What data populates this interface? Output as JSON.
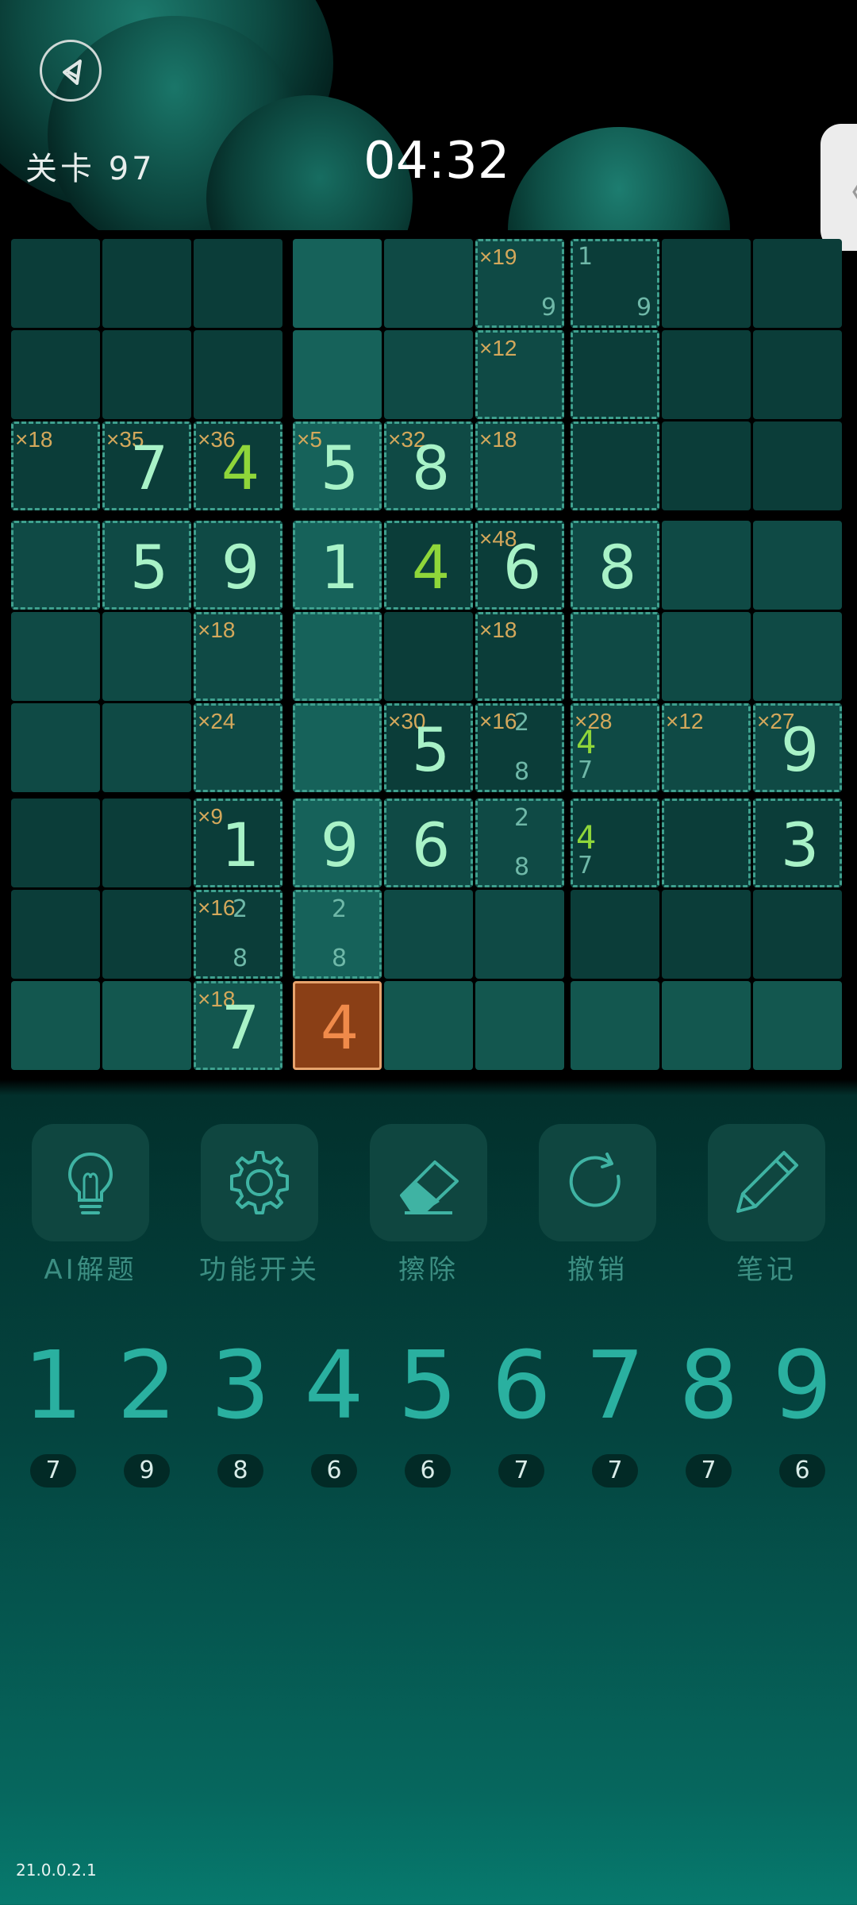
{
  "header": {
    "level": "关卡 97",
    "timer": "04:32",
    "side_tab_glyph": "〈"
  },
  "tools": [
    {
      "label": "AI解题",
      "icon": "lightbulb-icon"
    },
    {
      "label": "功能开关",
      "icon": "gear-icon"
    },
    {
      "label": "擦除",
      "icon": "eraser-icon"
    },
    {
      "label": "撤销",
      "icon": "undo-icon"
    },
    {
      "label": "笔记",
      "icon": "pencil-icon"
    }
  ],
  "number_pad": [
    {
      "digit": "1",
      "count": "7"
    },
    {
      "digit": "2",
      "count": "9"
    },
    {
      "digit": "3",
      "count": "8"
    },
    {
      "digit": "4",
      "count": "6"
    },
    {
      "digit": "5",
      "count": "6"
    },
    {
      "digit": "6",
      "count": "7"
    },
    {
      "digit": "7",
      "count": "7"
    },
    {
      "digit": "8",
      "count": "7"
    },
    {
      "digit": "9",
      "count": "6"
    }
  ],
  "version": "21.0.0.2.1",
  "colors": {
    "accent": "#2ab0a0",
    "selected_cell": "#8a3f16",
    "cage_label": "#d4a85b"
  },
  "board": {
    "cells": [
      {
        "r": 0,
        "c": 5,
        "cage": true,
        "label": "×19",
        "notes": [
          {
            "t": "9",
            "pos": "br"
          }
        ]
      },
      {
        "r": 0,
        "c": 6,
        "cage": true,
        "notes": [
          {
            "t": "1",
            "pos": "tl"
          },
          {
            "t": "9",
            "pos": "br"
          }
        ]
      },
      {
        "r": 1,
        "c": 5,
        "cage": true,
        "label": "×12"
      },
      {
        "r": 1,
        "c": 6,
        "cage": true
      },
      {
        "r": 2,
        "c": 0,
        "cage": true,
        "label": "×18"
      },
      {
        "r": 2,
        "c": 1,
        "cage": true,
        "label": "×35",
        "digit": "7"
      },
      {
        "r": 2,
        "c": 2,
        "cage": true,
        "label": "×36",
        "digit": "4",
        "given": true
      },
      {
        "r": 2,
        "c": 3,
        "cage": true,
        "label": "×5",
        "digit": "5"
      },
      {
        "r": 2,
        "c": 4,
        "cage": true,
        "label": "×32",
        "digit": "8"
      },
      {
        "r": 2,
        "c": 5,
        "cage": true,
        "label": "×18"
      },
      {
        "r": 2,
        "c": 6,
        "cage": true
      },
      {
        "r": 3,
        "c": 0,
        "cage": true
      },
      {
        "r": 3,
        "c": 1,
        "cage": true,
        "digit": "5"
      },
      {
        "r": 3,
        "c": 2,
        "cage": true,
        "digit": "9"
      },
      {
        "r": 3,
        "c": 3,
        "cage": true,
        "digit": "1"
      },
      {
        "r": 3,
        "c": 4,
        "cage": true,
        "digit": "4",
        "given": true
      },
      {
        "r": 3,
        "c": 5,
        "cage": true,
        "label": "×48",
        "digit": "6"
      },
      {
        "r": 3,
        "c": 6,
        "cage": true,
        "digit": "8"
      },
      {
        "r": 4,
        "c": 2,
        "cage": true,
        "label": "×18"
      },
      {
        "r": 4,
        "c": 3,
        "cage": true
      },
      {
        "r": 4,
        "c": 5,
        "cage": true,
        "label": "×18"
      },
      {
        "r": 4,
        "c": 6,
        "cage": true
      },
      {
        "r": 5,
        "c": 2,
        "cage": true,
        "label": "×24"
      },
      {
        "r": 5,
        "c": 3,
        "cage": true
      },
      {
        "r": 5,
        "c": 4,
        "cage": true,
        "label": "×30",
        "digit": "5"
      },
      {
        "r": 5,
        "c": 5,
        "cage": true,
        "label": "×16",
        "notes": [
          {
            "t": "2",
            "pos": "tm"
          },
          {
            "t": "8",
            "pos": "bm"
          }
        ]
      },
      {
        "r": 5,
        "c": 6,
        "cage": true,
        "label": "×28",
        "notes": [
          {
            "t": "4",
            "pos": "ml",
            "green": true
          },
          {
            "t": "7",
            "pos": "bl"
          }
        ]
      },
      {
        "r": 5,
        "c": 7,
        "cage": true,
        "label": "×12"
      },
      {
        "r": 5,
        "c": 8,
        "cage": true,
        "label": "×27",
        "digit": "9"
      },
      {
        "r": 6,
        "c": 2,
        "cage": true,
        "label": "×9",
        "digit": "1"
      },
      {
        "r": 6,
        "c": 3,
        "cage": true,
        "digit": "9"
      },
      {
        "r": 6,
        "c": 4,
        "cage": true,
        "digit": "6"
      },
      {
        "r": 6,
        "c": 5,
        "cage": true,
        "notes": [
          {
            "t": "2",
            "pos": "tm"
          },
          {
            "t": "8",
            "pos": "bm"
          }
        ]
      },
      {
        "r": 6,
        "c": 6,
        "cage": true,
        "notes": [
          {
            "t": "4",
            "pos": "ml",
            "green": true
          },
          {
            "t": "7",
            "pos": "bl"
          }
        ]
      },
      {
        "r": 6,
        "c": 7,
        "cage": true
      },
      {
        "r": 6,
        "c": 8,
        "cage": true,
        "digit": "3"
      },
      {
        "r": 7,
        "c": 2,
        "cage": true,
        "label": "×16",
        "notes": [
          {
            "t": "2",
            "pos": "tm"
          },
          {
            "t": "8",
            "pos": "bm"
          }
        ]
      },
      {
        "r": 7,
        "c": 3,
        "cage": true,
        "notes": [
          {
            "t": "2",
            "pos": "tm"
          },
          {
            "t": "8",
            "pos": "bm"
          }
        ]
      },
      {
        "r": 8,
        "c": 2,
        "cage": true,
        "label": "×18",
        "digit": "7"
      },
      {
        "r": 8,
        "c": 3,
        "selected": true,
        "digit": "4"
      }
    ]
  }
}
